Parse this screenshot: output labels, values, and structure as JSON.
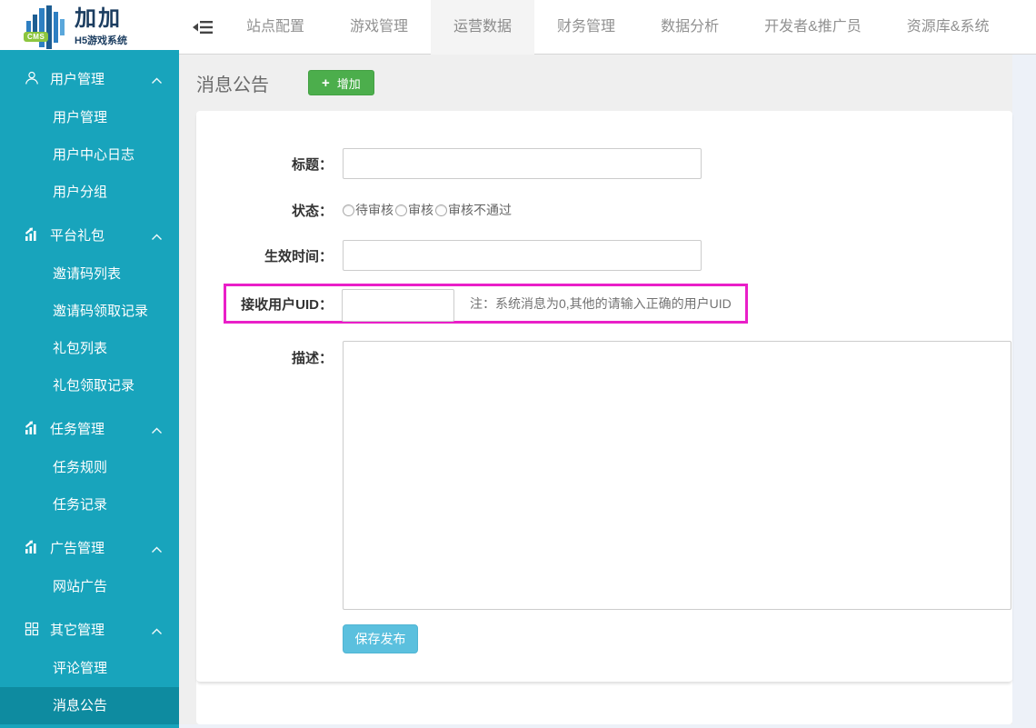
{
  "header": {
    "logo": {
      "badge": "CMS",
      "title": "加加",
      "subtitle": "H5游戏系统"
    },
    "tabs": [
      {
        "label": "站点配置",
        "active": false
      },
      {
        "label": "游戏管理",
        "active": false
      },
      {
        "label": "运营数据",
        "active": true
      },
      {
        "label": "财务管理",
        "active": false
      },
      {
        "label": "数据分析",
        "active": false
      },
      {
        "label": "开发者&推广员",
        "active": false
      },
      {
        "label": "资源库&系统",
        "active": false
      }
    ]
  },
  "sidebar": {
    "groups": [
      {
        "icon": "user-icon",
        "label": "用户管理",
        "items": [
          "用户管理",
          "用户中心日志",
          "用户分组"
        ]
      },
      {
        "icon": "chart-icon",
        "label": "平台礼包",
        "items": [
          "邀请码列表",
          "邀请码领取记录",
          "礼包列表",
          "礼包领取记录"
        ]
      },
      {
        "icon": "chart-icon",
        "label": "任务管理",
        "items": [
          "任务规则",
          "任务记录"
        ]
      },
      {
        "icon": "chart-icon",
        "label": "广告管理",
        "items": [
          "网站广告"
        ]
      },
      {
        "icon": "grid-icon",
        "label": "其它管理",
        "items": [
          "评论管理",
          "消息公告"
        ]
      }
    ],
    "active_item": "消息公告"
  },
  "page": {
    "title": "消息公告",
    "add_button_label": "增加"
  },
  "form": {
    "title": {
      "label": "标题：",
      "value": ""
    },
    "status": {
      "label": "状态：",
      "options": [
        "待审核",
        "审核",
        "审核不通过"
      ],
      "selected": ""
    },
    "effective_time": {
      "label": "生效时间：",
      "value": ""
    },
    "uid": {
      "label": "接收用户UID：",
      "value": "",
      "note": "注：系统消息为0,其他的请输入正确的用户UID"
    },
    "description": {
      "label": "描述：",
      "value": ""
    },
    "submit_label": "保存发布"
  },
  "colors": {
    "sidebar": "#18a4bc",
    "sidebar_active": "#0e8ba0",
    "add_button_green": "#4cae4c",
    "submit_button_blue": "#5bc0de",
    "highlight_magenta": "#e91fc8",
    "active_tab_bg": "#f4f4f4",
    "logo_navy": "#1b3d60",
    "logo_badge_green": "#8dc63f"
  }
}
